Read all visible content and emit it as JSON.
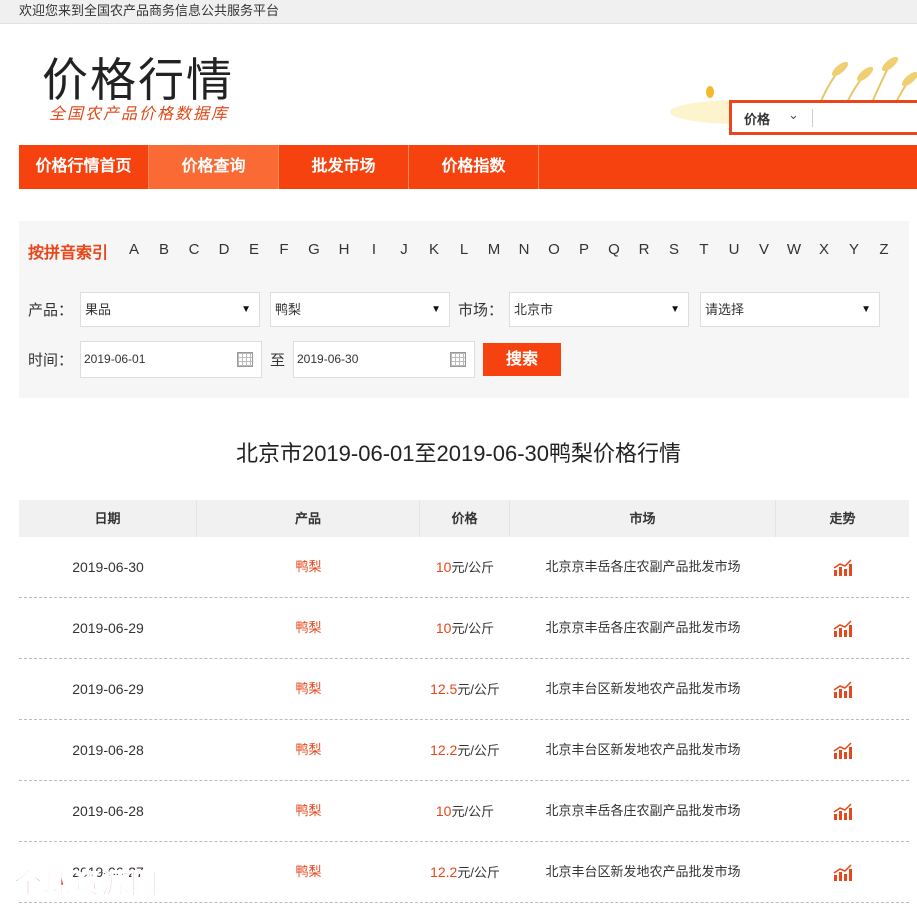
{
  "topbar": {
    "welcome": "欢迎您来到全国农产品商务信息公共服务平台"
  },
  "header": {
    "title": "价格行情",
    "subtitle": "全国农产品价格数据库",
    "search": {
      "type_label": "价格",
      "placeholder": ""
    }
  },
  "nav": {
    "items": [
      {
        "label": "价格行情首页"
      },
      {
        "label": "价格查询"
      },
      {
        "label": "批发市场"
      },
      {
        "label": "价格指数"
      }
    ],
    "active_index": 1
  },
  "filter": {
    "pinyin_label": "按拼音索引",
    "letters": [
      "A",
      "B",
      "C",
      "D",
      "E",
      "F",
      "G",
      "H",
      "I",
      "J",
      "K",
      "L",
      "M",
      "N",
      "O",
      "P",
      "Q",
      "R",
      "S",
      "T",
      "U",
      "V",
      "W",
      "X",
      "Y",
      "Z"
    ],
    "product_label": "产品：",
    "category_value": "果品",
    "product_value": "鸭梨",
    "market_label": "市场：",
    "market_value": "北京市",
    "market2_value": "请选择",
    "time_label": "时间：",
    "date_from": "2019-06-01",
    "to_label": "至",
    "date_to": "2019-06-30",
    "search_button": "搜索"
  },
  "result_title": "北京市2019-06-01至2019-06-30鸭梨价格行情",
  "table": {
    "headers": [
      "日期",
      "产品",
      "价格",
      "市场",
      "走势"
    ],
    "unit": "元/公斤",
    "rows": [
      {
        "date": "2019-06-30",
        "product": "鸭梨",
        "price": "10",
        "market": "北京京丰岳各庄农副产品批发市场"
      },
      {
        "date": "2019-06-29",
        "product": "鸭梨",
        "price": "10",
        "market": "北京京丰岳各庄农副产品批发市场"
      },
      {
        "date": "2019-06-29",
        "product": "鸭梨",
        "price": "12.5",
        "market": "北京丰台区新发地农产品批发市场"
      },
      {
        "date": "2019-06-28",
        "product": "鸭梨",
        "price": "12.2",
        "market": "北京丰台区新发地农产品批发市场"
      },
      {
        "date": "2019-06-28",
        "product": "鸭梨",
        "price": "10",
        "market": "北京京丰岳各庄农副产品批发市场"
      },
      {
        "date": "2019-06-27",
        "product": "鸭梨",
        "price": "12.2",
        "market": "北京丰台区新发地农产品批发市场"
      }
    ]
  },
  "watermark": "全球资源网",
  "colors": {
    "accent": "#f5420e",
    "accent_light": "#f96a35",
    "text": "#333333"
  },
  "icons": {
    "trend": "trend-chart-icon",
    "calendar": "calendar-icon",
    "dropdown": "chevron-down-icon"
  }
}
